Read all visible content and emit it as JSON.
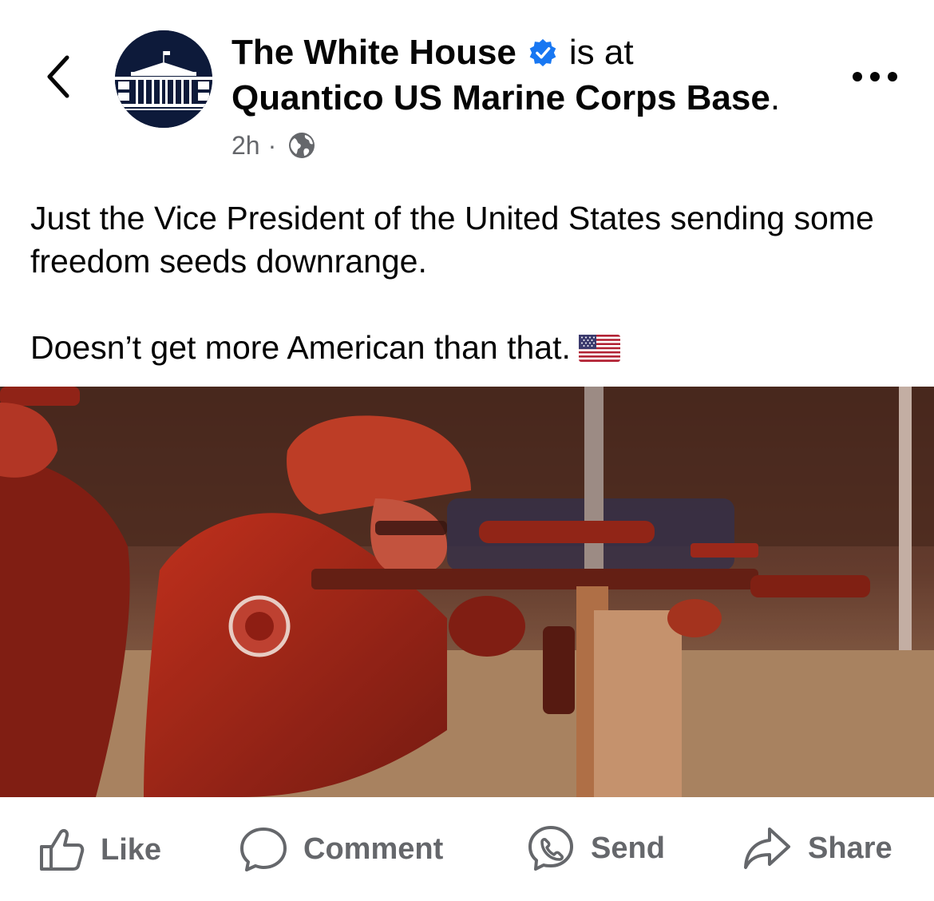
{
  "header": {
    "author": "The White House",
    "verb": "is at",
    "location": "Quantico US Marine Corps Base",
    "location_period": ".",
    "time": "2h",
    "separator": "·",
    "icons": {
      "back": "chevron-left-icon",
      "verified": "verified-badge-icon",
      "privacy": "globe-icon",
      "more": "more-dots-icon"
    }
  },
  "post": {
    "line1": "Just the Vice President of the United States sending some freedom seeds downrange.",
    "line2": "Doesn’t get more American than that.",
    "emoji": "us-flag-emoji"
  },
  "actions": {
    "like": "Like",
    "comment": "Comment",
    "send": "Send",
    "share": "Share"
  },
  "colors": {
    "verified": "#1877f2",
    "secondary_text": "#65676b",
    "avatar_bg": "#0d1a3a"
  }
}
